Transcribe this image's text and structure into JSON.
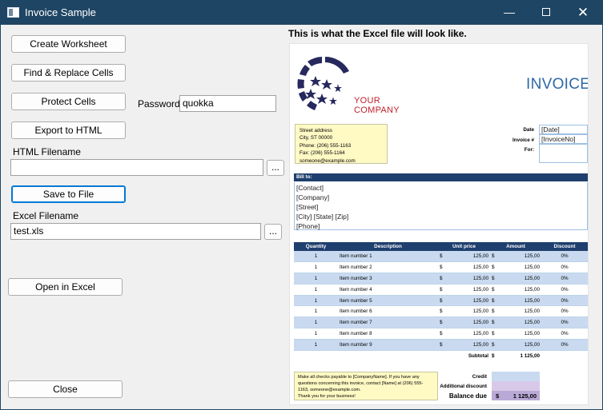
{
  "window": {
    "title": "Invoice Sample",
    "minimize_glyph": "—",
    "close_glyph": "✕"
  },
  "buttons": {
    "create_worksheet": "Create Worksheet",
    "find_replace": "Find & Replace Cells",
    "protect_cells": "Protect Cells",
    "export_html": "Export to HTML",
    "save_to_file": "Save to File",
    "open_in_excel": "Open in Excel",
    "close": "Close",
    "browse": "..."
  },
  "password": {
    "label": "Password",
    "value": "quokka"
  },
  "html_filename": {
    "label": "HTML Filename",
    "value": ""
  },
  "excel_filename": {
    "label": "Excel Filename",
    "value": "test.xls"
  },
  "preview": {
    "caption": "This is what the Excel file will look like.",
    "logo_line1": "YOUR",
    "logo_line2": "COMPANY",
    "invoice_title": "INVOICE",
    "address_lines": [
      "Street address",
      "City, ST 00000",
      "Phone: (206) 555-1163",
      "Fax: (206) 555-1164",
      "someone@example.com"
    ],
    "meta": [
      {
        "label": "Date",
        "value": "[Date]"
      },
      {
        "label": "Invoice #",
        "value": "[InvoiceNo]"
      },
      {
        "label": "For:",
        "value": ""
      }
    ],
    "bill_to_header": "Bill to:",
    "bill_to_lines": [
      "[Contact]",
      "[Company]",
      "[Street]",
      "[City] [State] [Zip]",
      "[Phone]"
    ],
    "columns": [
      "Quantity",
      "Description",
      "Unit price",
      "Amount",
      "Discount"
    ],
    "currency": "$",
    "items": [
      {
        "qty": "1",
        "desc": "Item number 1",
        "unit": "125,00",
        "amount": "125,00",
        "discount": "0%"
      },
      {
        "qty": "1",
        "desc": "Item number 2",
        "unit": "125,00",
        "amount": "125,00",
        "discount": "0%"
      },
      {
        "qty": "1",
        "desc": "Item number 3",
        "unit": "125,00",
        "amount": "125,00",
        "discount": "0%"
      },
      {
        "qty": "1",
        "desc": "Item number 4",
        "unit": "125,00",
        "amount": "125,00",
        "discount": "0%"
      },
      {
        "qty": "1",
        "desc": "Item number 5",
        "unit": "125,00",
        "amount": "125,00",
        "discount": "0%"
      },
      {
        "qty": "1",
        "desc": "Item number 6",
        "unit": "125,00",
        "amount": "125,00",
        "discount": "0%"
      },
      {
        "qty": "1",
        "desc": "Item number 7",
        "unit": "125,00",
        "amount": "125,00",
        "discount": "0%"
      },
      {
        "qty": "1",
        "desc": "Item number 8",
        "unit": "125,00",
        "amount": "125,00",
        "discount": "0%"
      },
      {
        "qty": "1",
        "desc": "Item number 9",
        "unit": "125,00",
        "amount": "125,00",
        "discount": "0%"
      }
    ],
    "subtotal_label": "Subtotal",
    "subtotal_value": "1 125,00",
    "note_lines": [
      "Make all checks payable to [CompanyName]. If you have any",
      "questions concerning this invoice, contact [Name] at (206) 555-",
      "1163, someone@example.com.",
      "Thank you for your business!"
    ],
    "credit_label": "Credit",
    "discount_label": "Additional discount",
    "balance_label": "Balance due",
    "balance_value": "1 125,00"
  },
  "colors": {
    "titlebar": "#1e4564",
    "accent": "#0078d4",
    "header_navy": "#1f3f6e",
    "logo_red": "#c0202c",
    "title_blue": "#2e68a6"
  }
}
